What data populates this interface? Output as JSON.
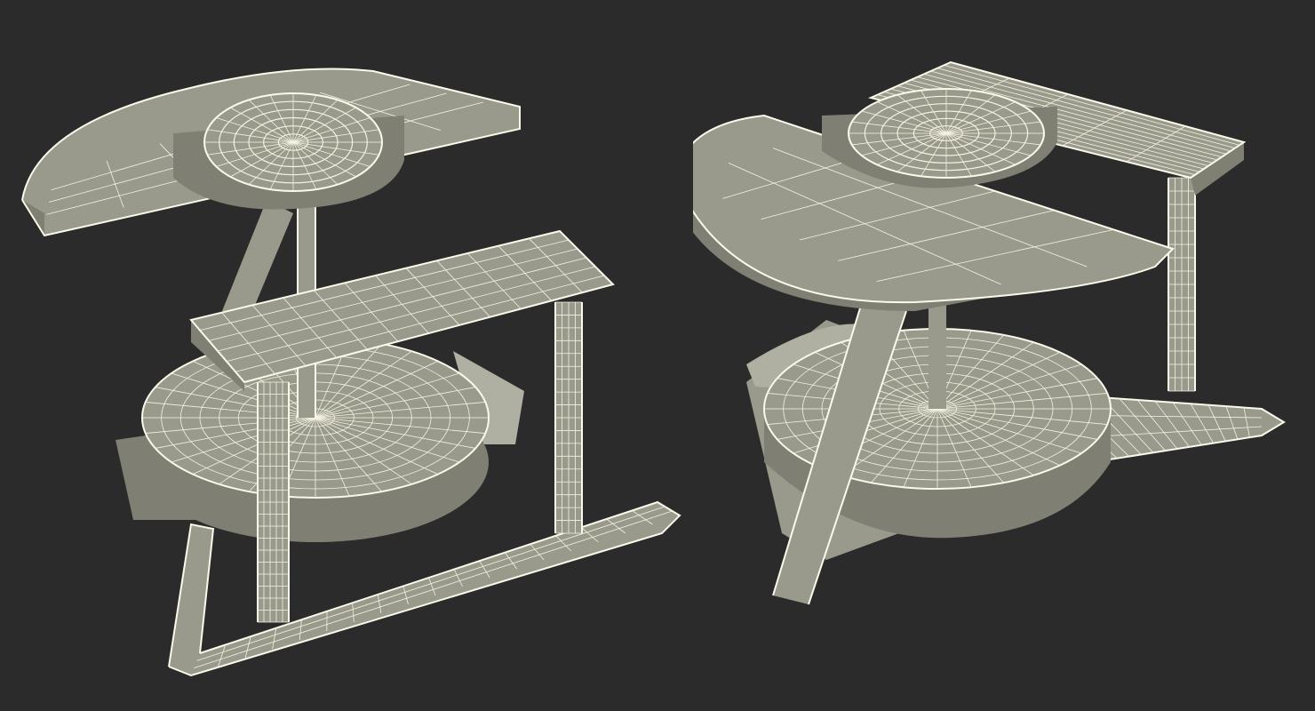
{
  "scene": {
    "background_color": "#2b2b2b",
    "surface_color": "#9a9a8c",
    "wire_color": "#f4f2e2",
    "objects": [
      {
        "id": "left-model",
        "view": "front-left"
      },
      {
        "id": "right-model",
        "view": "back-right"
      }
    ]
  }
}
